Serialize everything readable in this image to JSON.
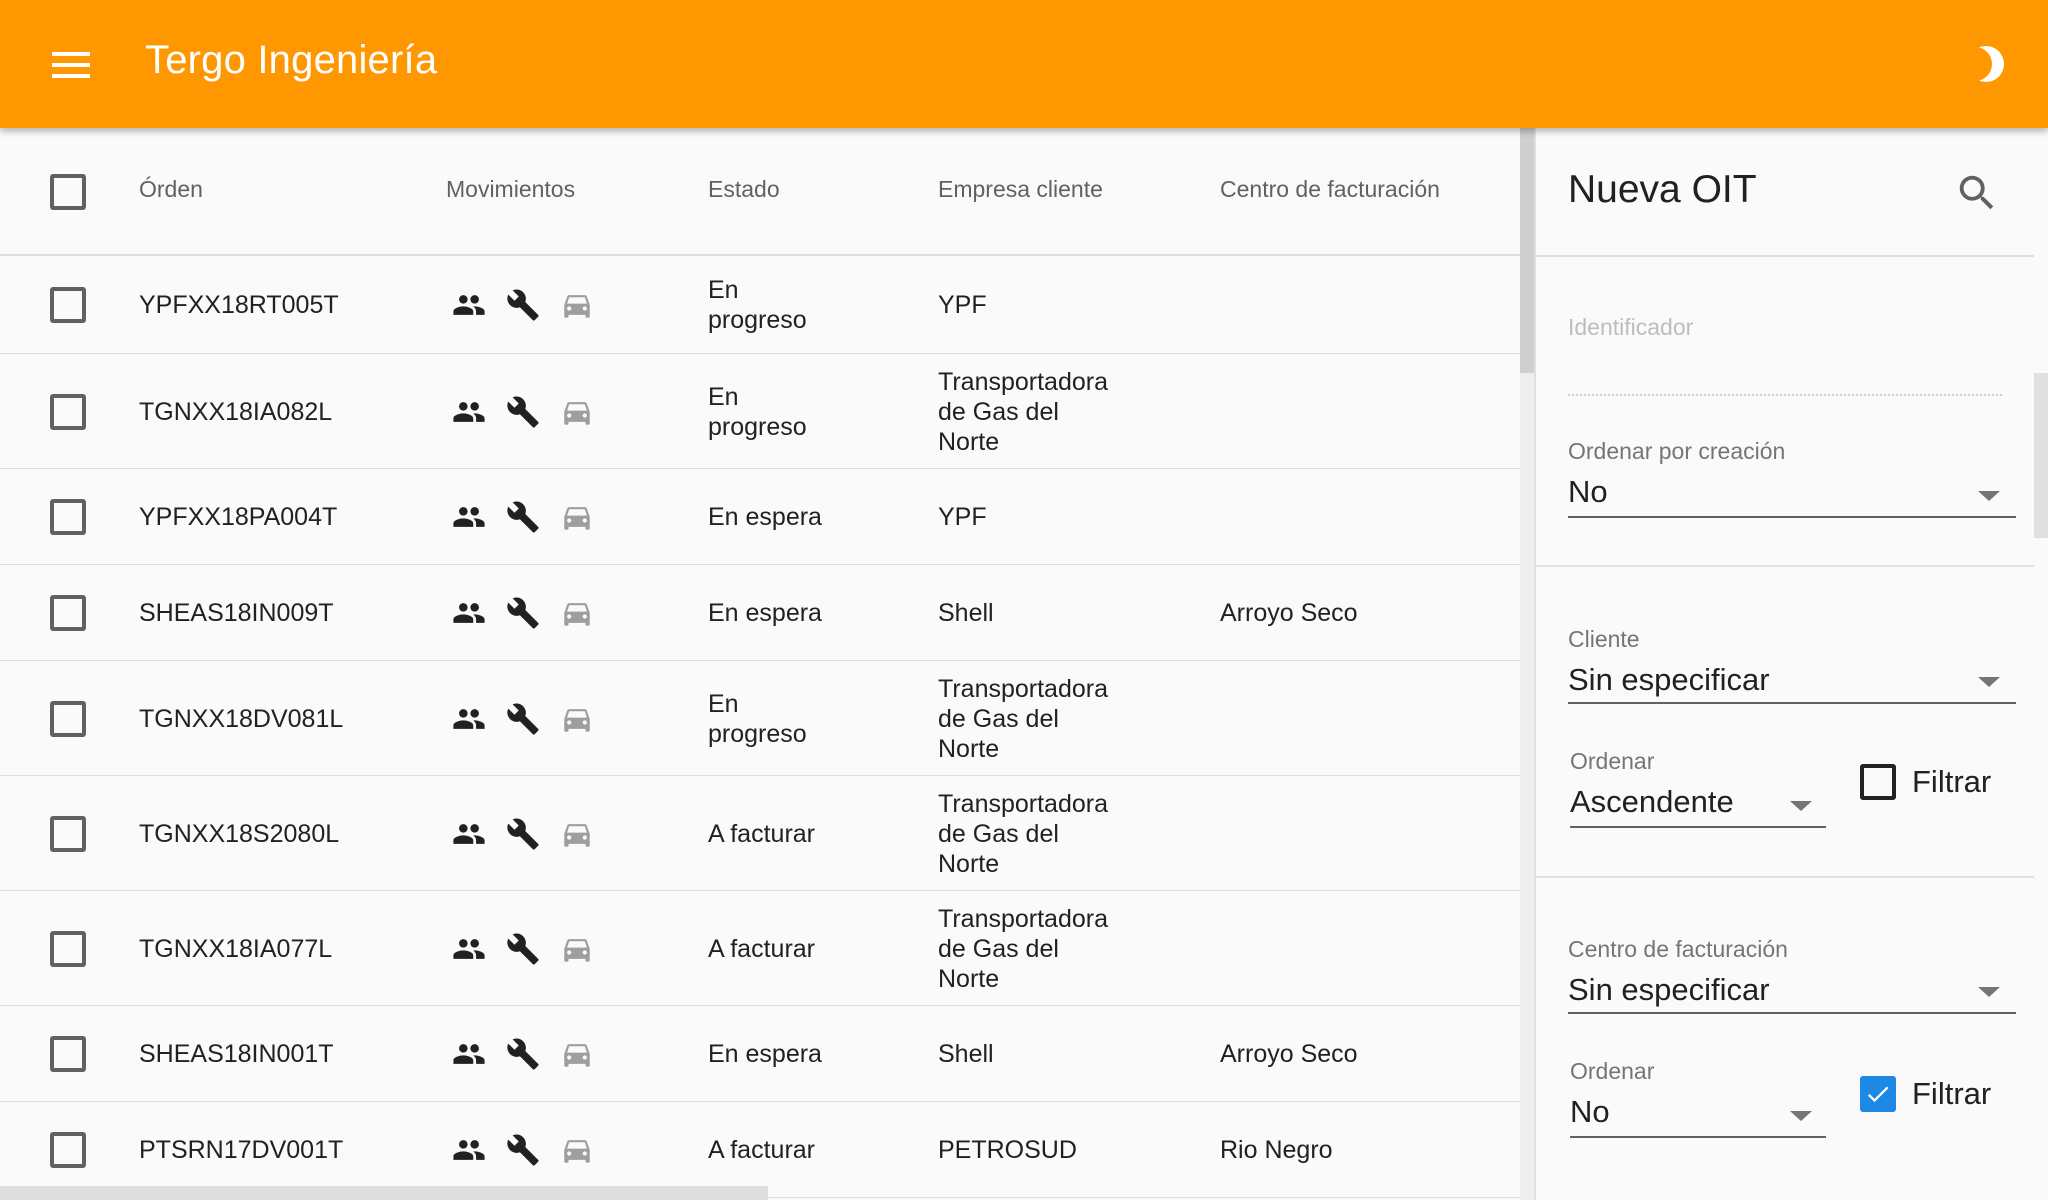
{
  "app": {
    "title": "Tergo Ingeniería"
  },
  "colors": {
    "appbar": "#ff9800",
    "checkbox_checked": "#1e88e5"
  },
  "table": {
    "headers": {
      "orden": "Órden",
      "movimientos": "Movimientos",
      "estado": "Estado",
      "empresa": "Empresa cliente",
      "centro": "Centro de facturación"
    },
    "row_icons": [
      "people-icon",
      "wrench-icon",
      "car-icon"
    ],
    "rows": [
      {
        "orden": "YPFXX18RT005T",
        "estado": [
          "En",
          "progreso"
        ],
        "empresa": [
          "YPF"
        ],
        "centro": ""
      },
      {
        "orden": "TGNXX18IA082L",
        "estado": [
          "En",
          "progreso"
        ],
        "empresa": [
          "Transportadora",
          "de Gas del",
          "Norte"
        ],
        "centro": ""
      },
      {
        "orden": "YPFXX18PA004T",
        "estado": [
          "En espera"
        ],
        "empresa": [
          "YPF"
        ],
        "centro": ""
      },
      {
        "orden": "SHEAS18IN009T",
        "estado": [
          "En espera"
        ],
        "empresa": [
          "Shell"
        ],
        "centro": "Arroyo Seco"
      },
      {
        "orden": "TGNXX18DV081L",
        "estado": [
          "En",
          "progreso"
        ],
        "empresa": [
          "Transportadora",
          "de Gas del",
          "Norte"
        ],
        "centro": ""
      },
      {
        "orden": "TGNXX18S2080L",
        "estado": [
          "A facturar"
        ],
        "empresa": [
          "Transportadora",
          "de Gas del",
          "Norte"
        ],
        "centro": ""
      },
      {
        "orden": "TGNXX18IA077L",
        "estado": [
          "A facturar"
        ],
        "empresa": [
          "Transportadora",
          "de Gas del",
          "Norte"
        ],
        "centro": ""
      },
      {
        "orden": "SHEAS18IN001T",
        "estado": [
          "En espera"
        ],
        "empresa": [
          "Shell"
        ],
        "centro": "Arroyo Seco"
      },
      {
        "orden": "PTSRN17DV001T",
        "estado": [
          "A facturar"
        ],
        "empresa": [
          "PETROSUD"
        ],
        "centro": "Rio Negro"
      }
    ]
  },
  "panel": {
    "title": "Nueva OIT",
    "identificador": {
      "placeholder": "Identificador",
      "value": ""
    },
    "ordenar_creacion": {
      "label": "Ordenar por creación",
      "value": "No"
    },
    "cliente": {
      "label": "Cliente",
      "value": "Sin especificar",
      "ordenar_label": "Ordenar",
      "ordenar_value": "Ascendente",
      "filtrar_label": "Filtrar",
      "filtrar_checked": false
    },
    "centro": {
      "label": "Centro de facturación",
      "value": "Sin especificar",
      "ordenar_label": "Ordenar",
      "ordenar_value": "No",
      "filtrar_label": "Filtrar",
      "filtrar_checked": true
    }
  }
}
